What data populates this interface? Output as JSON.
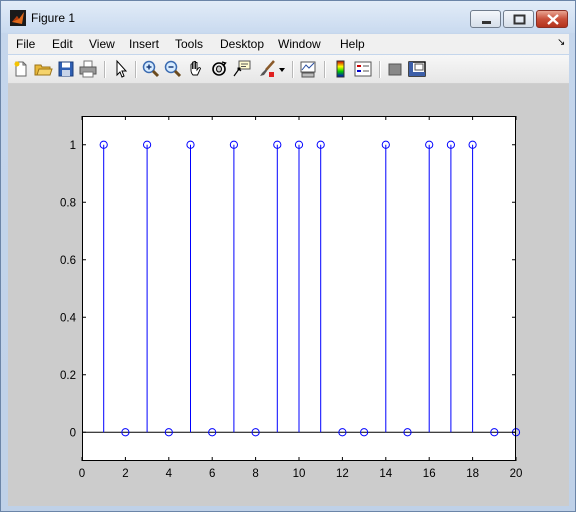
{
  "window": {
    "title": "Figure 1",
    "buttons": {
      "minimize": "minimize",
      "maximize": "maximize",
      "close": "close"
    }
  },
  "menu": [
    "File",
    "Edit",
    "View",
    "Insert",
    "Tools",
    "Desktop",
    "Window",
    "Help"
  ],
  "toolbar": {
    "icons": [
      "new-file-icon",
      "open-file-icon",
      "save-icon",
      "print-icon",
      "pointer-icon",
      "zoom-in-icon",
      "zoom-out-icon",
      "pan-icon",
      "rotate-3d-icon",
      "data-cursor-icon",
      "brush-icon",
      "brush-dropdown-icon",
      "link-plot-icon",
      "colorbar-icon",
      "legend-icon",
      "hide-plot-tools-icon",
      "show-plot-tools-icon"
    ]
  },
  "chart_data": {
    "type": "stem",
    "x": [
      1,
      2,
      3,
      4,
      5,
      6,
      7,
      8,
      9,
      10,
      11,
      12,
      13,
      14,
      15,
      16,
      17,
      18,
      19,
      20
    ],
    "y": [
      1,
      0,
      1,
      0,
      1,
      0,
      1,
      0,
      1,
      1,
      1,
      0,
      0,
      1,
      0,
      1,
      1,
      1,
      0,
      0
    ],
    "xlim": [
      0,
      20
    ],
    "ylim": [
      -0.1,
      1.1
    ],
    "xticks": [
      "0",
      "2",
      "4",
      "6",
      "8",
      "10",
      "12",
      "14",
      "16",
      "18",
      "20"
    ],
    "yticks": [
      "0",
      "0.2",
      "0.4",
      "0.6",
      "0.8",
      "1"
    ],
    "marker": "circle",
    "color": "#0000ff",
    "grid": false,
    "title": "",
    "xlabel": "",
    "ylabel": ""
  }
}
